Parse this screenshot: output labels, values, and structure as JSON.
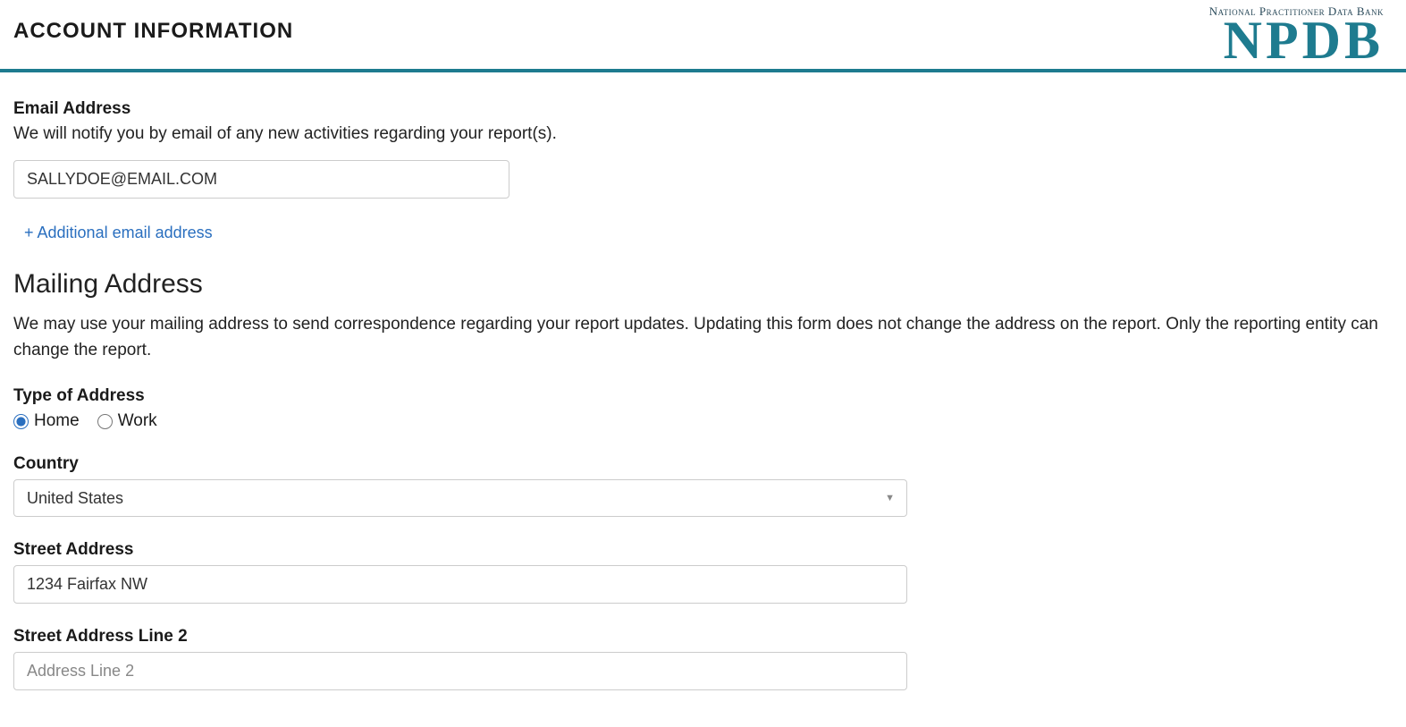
{
  "header": {
    "title": "ACCOUNT INFORMATION",
    "logo_tagline": "National Practitioner Data Bank",
    "logo_main": "NPDB"
  },
  "email": {
    "label": "Email Address",
    "help": "We will notify you by email of any new activities regarding your report(s).",
    "value": "SALLYDOE@EMAIL.COM",
    "add_link": "+ Additional email address"
  },
  "mailing": {
    "heading": "Mailing Address",
    "desc": "We may use your mailing address to send correspondence regarding your report updates. Updating this form does not change the address on the report. Only the reporting entity can change the report.",
    "type_label": "Type of Address",
    "type_options": {
      "home": "Home",
      "work": "Work"
    },
    "type_selected": "home",
    "country_label": "Country",
    "country_value": "United States",
    "street_label": "Street Address",
    "street_value": "1234 Fairfax NW",
    "street2_label": "Street Address Line 2",
    "street2_placeholder": "Address Line 2",
    "street2_value": ""
  }
}
